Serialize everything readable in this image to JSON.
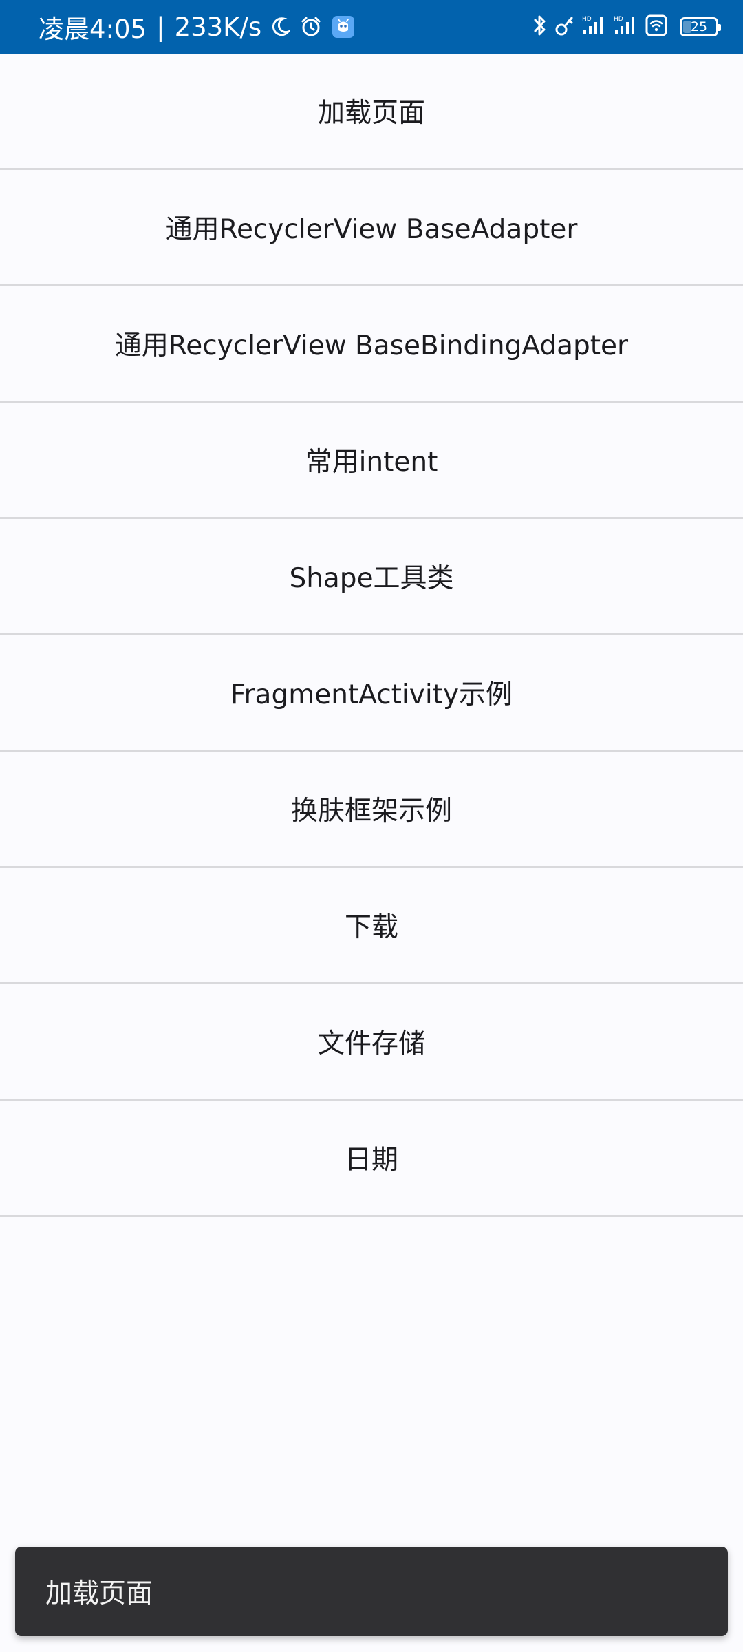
{
  "status_bar": {
    "time": "凌晨4:05",
    "separator": "|",
    "network_speed": "233K/s",
    "battery_level": "25",
    "battery_percent": 25,
    "background_color": "#0262ad",
    "icons": [
      "moon-icon",
      "alarm-icon",
      "app-notification-icon",
      "bluetooth-icon",
      "key-icon",
      "signal-hd-1-icon",
      "signal-hd-2-icon",
      "wifi-icon",
      "battery-icon"
    ]
  },
  "menu": {
    "items": [
      {
        "label": "加载页面"
      },
      {
        "label": "通用RecyclerView BaseAdapter"
      },
      {
        "label": "通用RecyclerView BaseBindingAdapter"
      },
      {
        "label": "常用intent"
      },
      {
        "label": "Shape工具类"
      },
      {
        "label": "FragmentActivity示例"
      },
      {
        "label": "换肤框架示例"
      },
      {
        "label": "下载"
      },
      {
        "label": "文件存储"
      },
      {
        "label": "日期"
      }
    ]
  },
  "toast": {
    "message": "加载页面"
  }
}
